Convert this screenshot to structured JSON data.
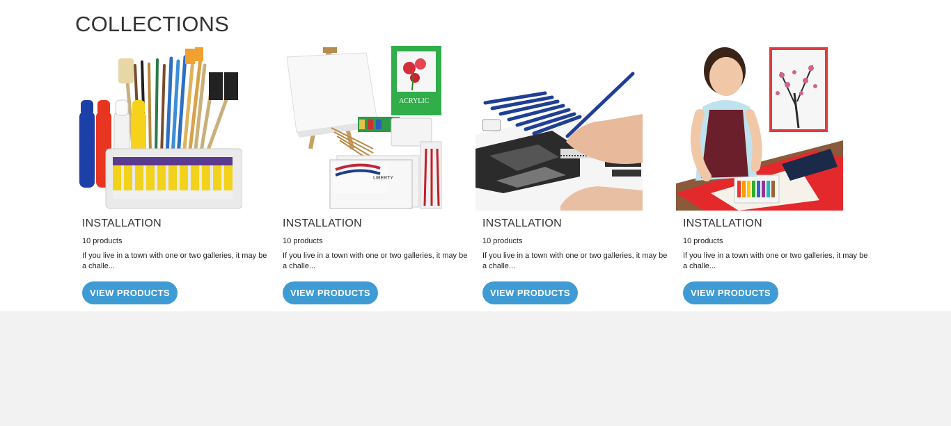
{
  "section": {
    "heading": "COLLECTIONS"
  },
  "collections": [
    {
      "title": "INSTALLATION",
      "count": "10 products",
      "description": "If you live in a town with one or two galleries, it may be a challe...",
      "button_label": "VIEW PRODUCTS",
      "image": "paint-brushes-and-tubes-set"
    },
    {
      "title": "INSTALLATION",
      "count": "10 products",
      "description": "If you live in a town with one or two galleries, it may be a challe...",
      "button_label": "VIEW PRODUCTS",
      "image": "easel-canvas-acrylic-set",
      "image_text": {
        "pad": "ACRYLIC",
        "canvas_brand": "LIBERTY"
      }
    },
    {
      "title": "INSTALLATION",
      "count": "10 products",
      "description": "If you live in a town with one or two galleries, it may be a challe...",
      "button_label": "VIEW PRODUCTS",
      "image": "hand-drawing-with-pencils"
    },
    {
      "title": "INSTALLATION",
      "count": "10 products",
      "description": "If you live in a town with one or two galleries, it may be a challe...",
      "button_label": "VIEW PRODUCTS",
      "image": "girl-painting-cherry-blossom"
    }
  ],
  "colors": {
    "button": "#3f9bd3",
    "page_background": "#f2f2f2",
    "section_background": "#ffffff"
  }
}
